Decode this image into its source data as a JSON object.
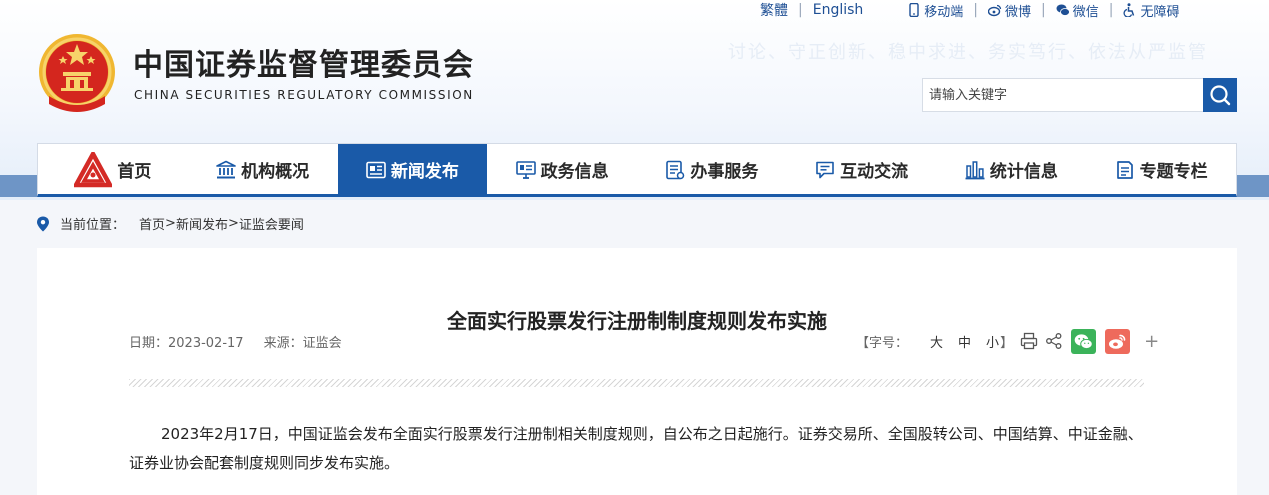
{
  "top_links": {
    "traditional": "繁體",
    "english": "English",
    "mobile": "移动端",
    "weibo": "微博",
    "wechat": "微信",
    "accessible": "无障碍"
  },
  "site": {
    "title": "中国证券监督管理委员会",
    "subtitle": "CHINA SECURITIES REGULATORY COMMISSION",
    "slogan": "讨论、守正创新、稳中求进、务实笃行、依法从严监管"
  },
  "search": {
    "placeholder": "请输入关键字"
  },
  "nav": {
    "items": [
      {
        "label": "首页",
        "icon": "csrc-logo-icon"
      },
      {
        "label": "机构概况",
        "icon": "institution-icon"
      },
      {
        "label": "新闻发布",
        "icon": "news-icon"
      },
      {
        "label": "政务信息",
        "icon": "gov-info-icon"
      },
      {
        "label": "办事服务",
        "icon": "service-icon"
      },
      {
        "label": "互动交流",
        "icon": "chat-icon"
      },
      {
        "label": "统计信息",
        "icon": "statistics-icon"
      },
      {
        "label": "专题专栏",
        "icon": "topic-icon"
      }
    ],
    "active_index": 2
  },
  "breadcrumb": {
    "label": "当前位置：",
    "items": [
      "首页",
      "新闻发布",
      "证监会要闻"
    ],
    "separator": ">"
  },
  "article": {
    "title": "全面实行股票发行注册制制度规则发布实施",
    "date": "日期：2023-02-17",
    "source": "来源：证监会",
    "font_size_label": "【字号：",
    "font_sizes": [
      "大",
      "中",
      "小"
    ],
    "font_size_close": "】",
    "body": "2023年2月17日，中国证监会发布全面实行股票发行注册制相关制度规则，自公布之日起施行。证券交易所、全国股转公司、中国结算、中证金融、证券业协会配套制度规则同步发布实施。"
  },
  "colors": {
    "primary": "#1a5aa8",
    "band": "#6e95c6",
    "wechat": "#3bb35a",
    "weibo": "#ee6a5c"
  }
}
